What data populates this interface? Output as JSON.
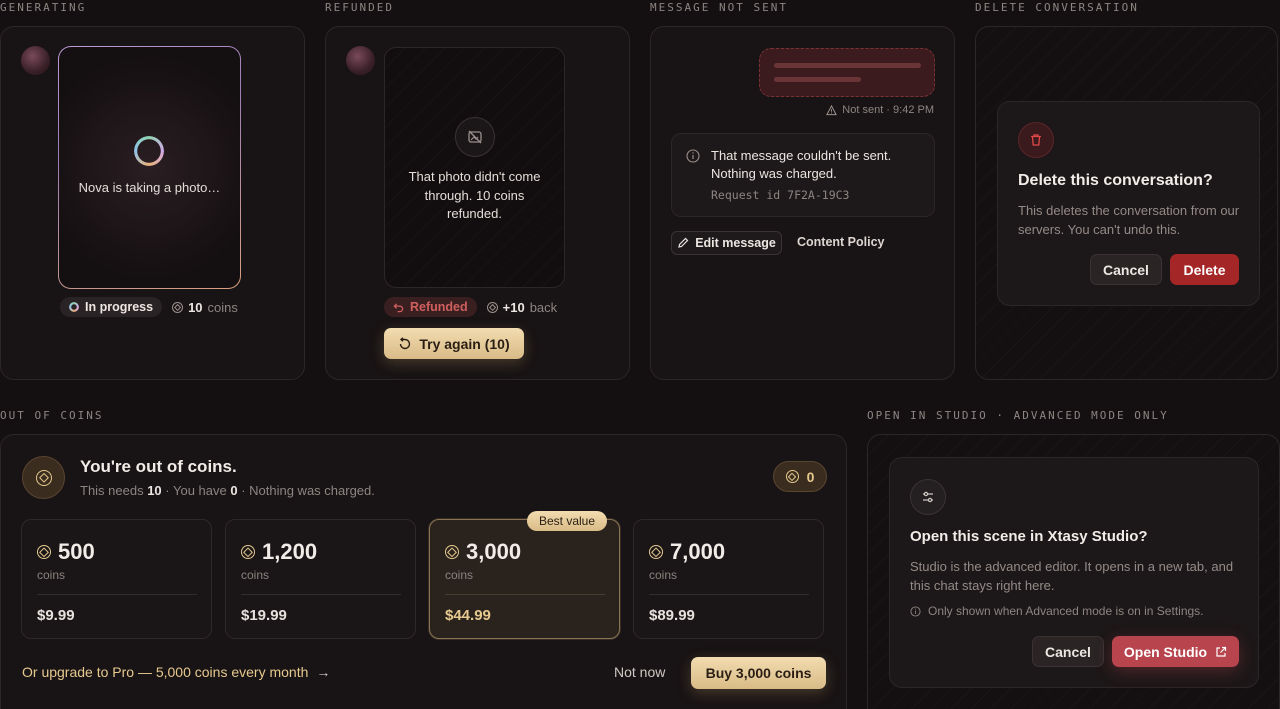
{
  "sections": {
    "generating": "GENERATING",
    "refunded": "REFUNDED",
    "not_sent": "MESSAGE NOT SENT",
    "delete": "DELETE CONVERSATION",
    "out_of_coins": "OUT OF COINS",
    "studio": "OPEN IN STUDIO · ADVANCED MODE ONLY"
  },
  "generating": {
    "caption": "Nova is taking a photo…",
    "status": "In progress",
    "coins_value": "10",
    "coins_unit": "coins"
  },
  "refunded": {
    "message": "That photo didn't come through. 10 coins refunded.",
    "status": "Refunded",
    "back_value": "+10",
    "back_unit": "back",
    "retry_label": "Try again (10)"
  },
  "not_sent": {
    "meta": "Not sent · 9:42 PM",
    "error_title": "That message couldn't be sent. Nothing was charged.",
    "request_id": "Request id 7F2A-19C3",
    "edit_label": "Edit message",
    "policy_label": "Content Policy"
  },
  "delete_dialog": {
    "title": "Delete this conversation?",
    "body": "This deletes the conversation from our servers. You can't undo this.",
    "cancel": "Cancel",
    "confirm": "Delete"
  },
  "out_of_coins": {
    "title": "You're out of coins.",
    "sub_needs": "This needs ",
    "sub_needs_val": "10",
    "sub_have": " · You have ",
    "sub_have_val": "0",
    "sub_tail": " · Nothing was charged.",
    "balance": "0",
    "badge": "Best value",
    "packs": [
      {
        "amount": "500",
        "unit": "coins",
        "price": "$9.99"
      },
      {
        "amount": "1,200",
        "unit": "coins",
        "price": "$19.99"
      },
      {
        "amount": "3,000",
        "unit": "coins",
        "price": "$44.99"
      },
      {
        "amount": "7,000",
        "unit": "coins",
        "price": "$89.99"
      }
    ],
    "upgrade": "Or upgrade to Pro — 5,000 coins every month",
    "not_now": "Not now",
    "buy": "Buy 3,000 coins"
  },
  "studio": {
    "title": "Open this scene in Xtasy Studio?",
    "body": "Studio is the advanced editor. It opens in a new tab, and this chat stays right here.",
    "note": "Only shown when Advanced mode is on in Settings.",
    "cancel": "Cancel",
    "open": "Open Studio"
  },
  "colors": {
    "accent_gold": "#e6c98f",
    "danger": "#a52626",
    "studio_btn": "#b8444e"
  }
}
